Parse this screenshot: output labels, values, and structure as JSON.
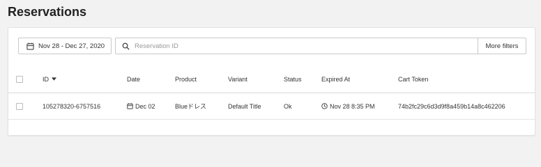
{
  "page": {
    "title": "Reservations"
  },
  "filters": {
    "date_range": "Nov 28 - Dec 27, 2020",
    "search_placeholder": "Reservation ID",
    "search_value": "",
    "more_filters_label": "More filters"
  },
  "table": {
    "columns": {
      "id": "ID",
      "date": "Date",
      "product": "Product",
      "variant": "Variant",
      "status": "Status",
      "expired_at": "Expired At",
      "cart_token": "Cart Token"
    },
    "rows": [
      {
        "id": "105278320-6757516",
        "date": "Dec 02",
        "product": "Blueドレス",
        "variant": "Default Title",
        "status": "Ok",
        "expired_at": "Nov 28 8:35 PM",
        "cart_token": "74b2fc29c6d3d9f8a459b14a8c462206"
      }
    ]
  },
  "icons": {
    "calendar": "calendar-icon",
    "search": "search-icon",
    "sort": "caret-down-icon",
    "clock": "clock-icon"
  },
  "colors": {
    "background": "#f2f2f2",
    "card": "#ffffff",
    "border": "#c9c9c9",
    "text": "#333333",
    "placeholder": "#999999"
  }
}
